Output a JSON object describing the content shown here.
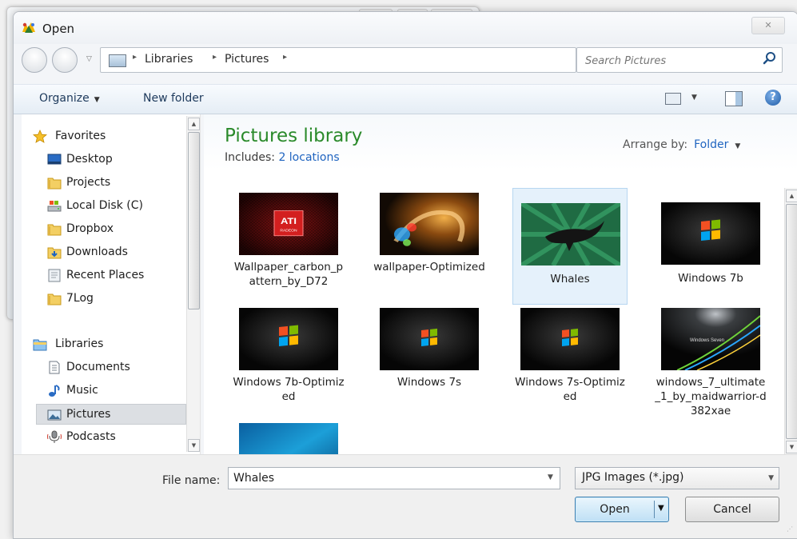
{
  "window": {
    "title": "Open",
    "close_glyph": "✕"
  },
  "address": {
    "crumbs": [
      "Libraries",
      "Pictures"
    ],
    "separator": "▸",
    "search_placeholder": "Search Pictures"
  },
  "toolbar": {
    "organize": "Organize",
    "new_folder": "New folder",
    "help": "?"
  },
  "nav": {
    "favorites": "Favorites",
    "desktop": "Desktop",
    "projects": "Projects",
    "local_disk": "Local Disk (C)",
    "dropbox": "Dropbox",
    "downloads": "Downloads",
    "recent_places": "Recent Places",
    "log7": "7Log",
    "libraries": "Libraries",
    "documents": "Documents",
    "music": "Music",
    "pictures": "Pictures",
    "podcasts": "Podcasts"
  },
  "library": {
    "title": "Pictures library",
    "includes_label": "Includes:",
    "includes_link": "2 locations",
    "arrange_label": "Arrange by:",
    "arrange_value": "Folder"
  },
  "files": [
    {
      "name": "Wallpaper_carbon_pattern_by_D72",
      "thumb": "ati-logo"
    },
    {
      "name": "wallpaper-Optimized",
      "thumb": "abstract-swirl"
    },
    {
      "name": "Whales",
      "thumb": "whale",
      "selected": true
    },
    {
      "name": "Windows 7b",
      "thumb": "windows-logo"
    },
    {
      "name": "Windows 7b-Optimized",
      "thumb": "windows-logo"
    },
    {
      "name": "Windows 7s",
      "thumb": "windows-logo"
    },
    {
      "name": "Windows 7s-Optimized",
      "thumb": "windows-logo"
    },
    {
      "name": "windows_7_ultimate_1_by_maidwarrior-d382xae",
      "thumb": "windows-seven-waves"
    },
    {
      "name": "",
      "thumb": "blue-aurora"
    }
  ],
  "thumb_texts": {
    "ati": "ATI",
    "ati_sub": "RADEON",
    "win_seven": "Windows Seven"
  },
  "footer": {
    "file_name_label": "File name:",
    "file_name_value": "Whales",
    "file_type": "JPG Images (*.jpg)",
    "open": "Open",
    "cancel": "Cancel"
  },
  "colors": {
    "library_title": "#2a8a2a",
    "link": "#1f64c0",
    "selection": "#e5f1fb"
  }
}
